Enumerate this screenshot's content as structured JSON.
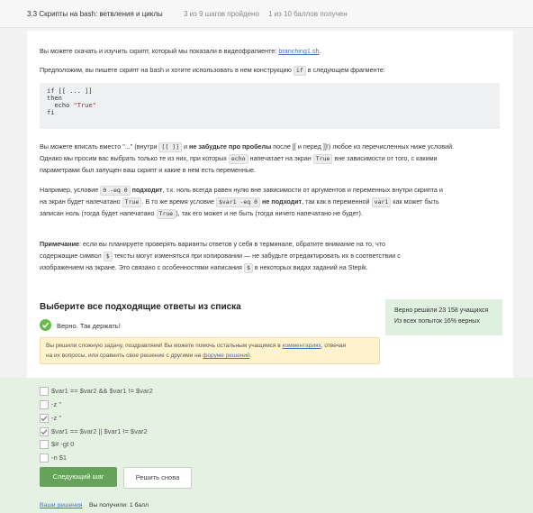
{
  "header": {
    "title": "3.3 Скрипты на bash: ветвления и циклы",
    "lesson_progress": "3 из 9 шагов пройдено",
    "score_progress": "1 из 10 баллов  получен"
  },
  "content": {
    "p1_text": "Вы можете скачать и изучить скрипт, который мы показали в видеофрагменте: ",
    "p1_link": "branching1.sh",
    "p1_end": ".",
    "p2_a": "Предположим, вы пишете скрипт на bash и хотите использовать в нем конструкцию ",
    "p2_code": "if",
    "p2_b": " в следующем фрагменте:",
    "code_lines": [
      "if [[ ... ]]",
      "then",
      "  echo ",
      "fi"
    ],
    "code_string": "\"True\"",
    "p3_l1_a": "Вы можете вписать вместо \"...\" (внутри ",
    "p3_l1_code": "[[ ]]",
    "p3_l1_b": " и ",
    "p3_l1_bold": "не забудьте про пробелы",
    "p3_l1_c": " после [[ и перед ]]!) любое из перечисленных ниже условий.",
    "p3_l2_a": "Однако мы просим вас выбрать только те из них, при которых ",
    "p3_l2_code1": "echo",
    "p3_l2_b": " напечатает на экран ",
    "p3_l2_code2": "True",
    "p3_l2_c": " вне зависимости от того, с какими",
    "p3_l3": "параметрами был запущен ваш скрипт и какие в нем есть переменные.",
    "p4_l1_a": "Например, условие ",
    "p4_l1_code": "0 -eq 0",
    "p4_l1_bold": " подходит",
    "p4_l1_b": ", т.к. ноль всегда равен нулю вне зависимости от аргументов и переменных внутри скрипта и",
    "p4_l2_a": "на экран будет напечатано ",
    "p4_l2_code1": "True",
    "p4_l2_b": ". В то же время условие ",
    "p4_l2_code2": "$var1 -eq 0",
    "p4_l2_bold": " не подходит",
    "p4_l2_c": ", так как в переменной ",
    "p4_l2_code3": "var1",
    "p4_l2_d": " как может быть",
    "p4_l3_a": "записан ноль (тогда будет напечатано ",
    "p4_l3_code": "True",
    "p4_l3_b": "), так его может и не быть (тогда ничего напечатано не будет).",
    "p5_l1_bold": "Примечание",
    "p5_l1_a": ": если вы планируете проверять варианты ответов у себя в терминале, обратите внимание на то, что",
    "p5_l2_a": "содержащие символ ",
    "p5_l2_code": "$",
    "p5_l2_b": " тексты могут изменяться при копировании — не забудьте отредактировать их в соответствии с",
    "p5_l3_a": "изображением на экране. Это связано с особенностями написания ",
    "p5_l3_code": "$",
    "p5_l3_b": " в некоторых видах заданий на Stepik."
  },
  "quiz": {
    "title": "Выберите все подходящие ответы из списка",
    "stats_line1": "Верно решили 23 158 учащихся",
    "stats_line2": "Из всех попыток 16% верных",
    "correct_text": "Верно. Так держать!",
    "notice_l1_a": "Вы решили сложную задачу, поздравляем! Вы можете помочь остальным учащимся в ",
    "notice_l1_link": "комментариях",
    "notice_l1_b": ", отвечая",
    "notice_l2_a": "на их вопросы, или сравнить свое решение с другими на ",
    "notice_l2_link": "форуме решений",
    "notice_l2_b": ".",
    "options": [
      {
        "label": "$var1 == $var2 && $var1 != $var2",
        "checked": false
      },
      {
        "label": "-z ''",
        "checked": false
      },
      {
        "label": "-z ''",
        "checked": true
      },
      {
        "label": "$var1 == $var2 || $var1 != $var2",
        "checked": true
      },
      {
        "label": "$# -gt 0",
        "checked": false
      },
      {
        "label": "-n $1",
        "checked": false
      }
    ],
    "next_button": "Следующий шаг",
    "retry_button": "Решить снова",
    "solutions_link": "Ваши решения",
    "score_text": "Вы получили: 1 балл"
  },
  "colors": {
    "accent_green": "#66a35a",
    "link": "#4a6fb5",
    "success": "#66bb4a"
  }
}
